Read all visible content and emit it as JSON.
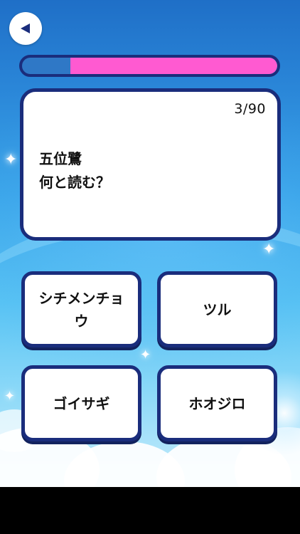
{
  "back_icon": "back-arrow-icon",
  "progress": {
    "value": 0.19,
    "track_color": "#2f78c6",
    "fill_color": "#ff5ad1"
  },
  "question_card": {
    "counter": "3/90",
    "line1": "五位鷺",
    "line2": "何と読む？"
  },
  "answers": [
    {
      "label": "シチメンチョウ"
    },
    {
      "label": "ツル"
    },
    {
      "label": "ゴイサギ"
    },
    {
      "label": "ホオジロ"
    }
  ],
  "colors": {
    "card_border": "#1a2d7c",
    "background": "#2a86d8"
  }
}
